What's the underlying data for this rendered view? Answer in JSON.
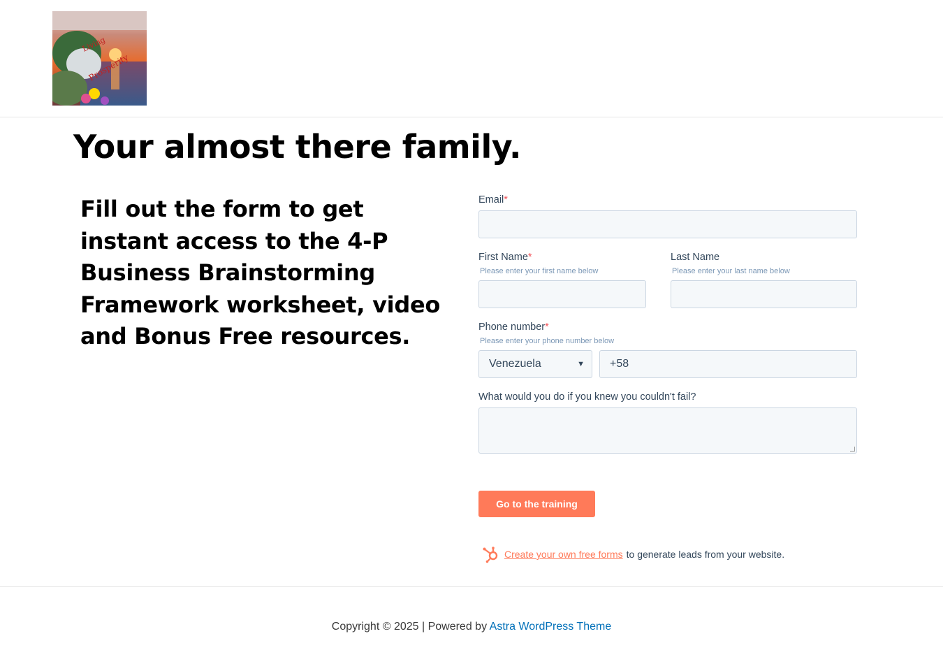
{
  "header": {
    "logo_alt": "site-logo"
  },
  "page": {
    "title": "Your almost there family.",
    "intro": "Fill out the form to get instant access to the 4-P Business Brainstorming Framework worksheet, video and Bonus Free resources."
  },
  "form": {
    "email": {
      "label": "Email",
      "required_mark": "*",
      "value": ""
    },
    "first_name": {
      "label": "First Name",
      "required_mark": "*",
      "hint": "Please enter your first name below",
      "value": ""
    },
    "last_name": {
      "label": "Last Name",
      "hint": "Please enter your last name below",
      "value": ""
    },
    "phone": {
      "label": "Phone number",
      "required_mark": "*",
      "hint": "Please enter your phone number below",
      "country": "Venezuela",
      "value": "+58"
    },
    "question": {
      "label": "What would you do if you knew you couldn't fail?",
      "value": ""
    },
    "submit_label": "Go to the training"
  },
  "hubspot": {
    "link_text": "Create your own free forms",
    "trailing_text": "to generate leads from your website."
  },
  "footer": {
    "copyright_prefix": "Copyright © 2025 | Powered by ",
    "theme_link": "Astra WordPress Theme"
  },
  "colors": {
    "accent": "#ff7a59",
    "required": "#f2545b",
    "link": "#0170b9",
    "field_bg": "#f5f8fa",
    "field_border": "#cbd6e2"
  }
}
